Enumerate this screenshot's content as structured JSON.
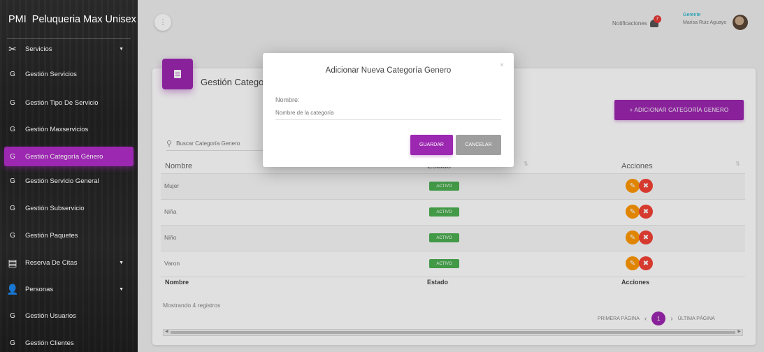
{
  "sidebar": {
    "brand_mini": "PMI",
    "brand_name": "Peluqueria Max Unisex",
    "items": [
      {
        "mark": "✂",
        "label": "Servicios",
        "caret": "▼"
      },
      {
        "mark": "G",
        "label": "Gestión Servicios"
      },
      {
        "mark": "G",
        "label": "Gestión Tipo De Servicio"
      },
      {
        "mark": "G",
        "label": "Gestión Maxservicios"
      },
      {
        "mark": "G",
        "label": "Gestión Categoría Género"
      },
      {
        "mark": "G",
        "label": "Gestión Servicio General"
      },
      {
        "mark": "G",
        "label": "Gestión Subservicio"
      },
      {
        "mark": "G",
        "label": "Gestión Paquetes"
      },
      {
        "mark": "▤",
        "label": "Reserva De Citas",
        "caret": "▼"
      },
      {
        "mark": "👤",
        "label": "Personas",
        "caret": "▼"
      },
      {
        "mark": "G",
        "label": "Gestión Usuarios"
      },
      {
        "mark": "G",
        "label": "Gestión Clientes"
      }
    ]
  },
  "topbar": {
    "menu_glyph": "⋮",
    "notifications_label": "Notificaciones",
    "notifications_count": "7",
    "user_role": "Gerente",
    "user_name": "Marisa Ruiz Aguayo"
  },
  "card": {
    "title": "Gestión Categoría Genero",
    "add_button": "+ ADICIONAR CATEGORÍA GENERO",
    "search_placeholder": "Buscar Categoría Genero",
    "columns": [
      "Nombre",
      "Estado",
      "Acciones"
    ],
    "footer_columns": [
      "Nombre",
      "Estado",
      "Acciones"
    ],
    "rows": [
      {
        "nombre": "Mujer",
        "estado": "ACTIVO"
      },
      {
        "nombre": "Niña",
        "estado": "ACTIVO"
      },
      {
        "nombre": "Niño",
        "estado": "ACTIVO"
      },
      {
        "nombre": "Varon",
        "estado": "ACTIVO"
      }
    ],
    "count_text": "Mostrando 4 registros",
    "pager": {
      "first": "PRIMERA PÁGINA",
      "current": "1",
      "last": "ÚLTIMA PÁGINA"
    }
  },
  "modal": {
    "title": "Adicionar Nueva Categoría Genero",
    "close": "×",
    "field_label": "Nombre:",
    "field_placeholder": "Nombre de la categoría",
    "field_value": "",
    "save": "GUARDAR",
    "cancel": "CANCELAR"
  },
  "colors": {
    "accent": "#9c27b0",
    "active_badge": "#4caf50",
    "edit": "#ff9800",
    "delete": "#f44336"
  }
}
